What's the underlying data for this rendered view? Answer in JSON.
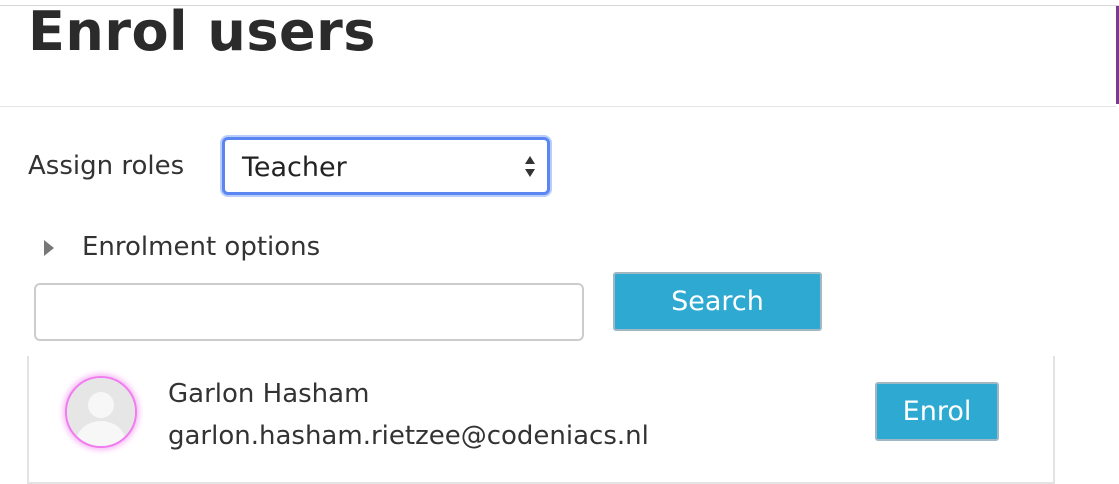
{
  "dialog": {
    "title": "Enrol users"
  },
  "roles": {
    "label": "Assign roles",
    "selected": "Teacher"
  },
  "enrolment_options": {
    "label": "Enrolment options",
    "expanded": false
  },
  "search": {
    "value": "",
    "placeholder": "",
    "button_label": "Search"
  },
  "results": [
    {
      "name": "Garlon Hasham",
      "email": "garlon.hasham.rietzee@codeniacs.nl",
      "action_label": "Enrol"
    }
  ],
  "icons": {
    "expand": "caret-right-icon",
    "select": "select-arrows-icon",
    "avatar": "default-user-avatar-icon"
  },
  "colors": {
    "button_background": "#2ea9d2",
    "focus_ring": "#5b86f2",
    "avatar_highlight": "#f07cf0"
  }
}
